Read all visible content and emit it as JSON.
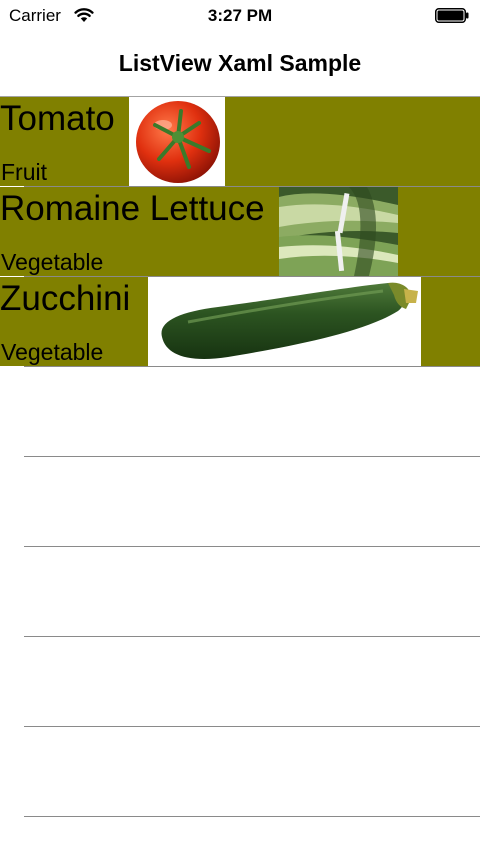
{
  "status_bar": {
    "carrier": "Carrier",
    "time": "3:27 PM",
    "battery_level": 1.0
  },
  "nav": {
    "title": "ListView Xaml Sample"
  },
  "colors": {
    "row_background": "#808000",
    "separator": "#8a8a8a"
  },
  "items": [
    {
      "name": "Tomato",
      "type": "Fruit",
      "image": "tomato-image"
    },
    {
      "name": "Romaine Lettuce",
      "type": "Vegetable",
      "image": "romaine-lettuce-image"
    },
    {
      "name": "Zucchini",
      "type": "Vegetable",
      "image": "zucchini-image"
    }
  ]
}
